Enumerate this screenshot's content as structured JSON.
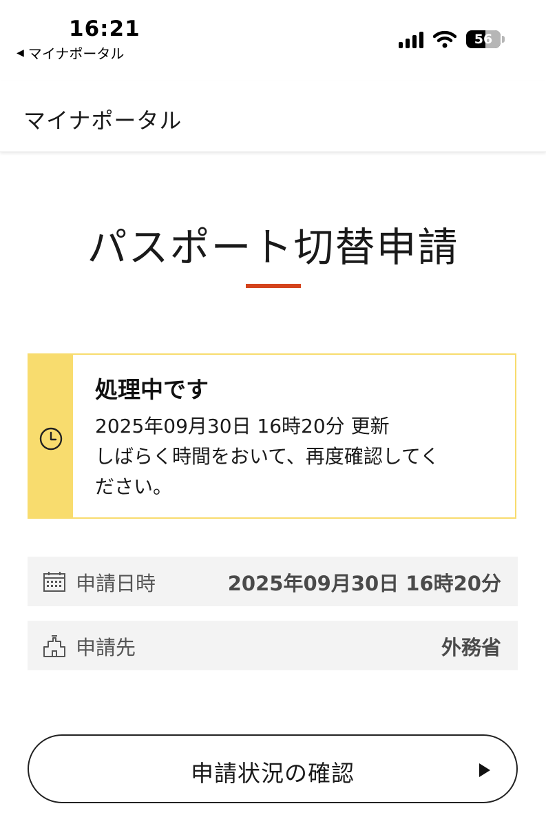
{
  "status_bar": {
    "time": "16:21",
    "back_arrow": "◀",
    "back_label": "マイナポータル",
    "battery": "56",
    "icons": [
      "cellular-signal-icon",
      "wifi-icon",
      "battery-icon"
    ]
  },
  "header": {
    "title": "マイナポータル"
  },
  "page": {
    "title": "パスポート切替申請",
    "accent_color": "#d4431c"
  },
  "status_box": {
    "heading": "処理中です",
    "updated": "2025年09月30日 16時20分 更新",
    "message_line1": "しばらく時間をおいて、再度確認してく",
    "message_line2": "ださい。",
    "icon": "clock-icon",
    "color": "#f8dc6e"
  },
  "info": {
    "date_label": "申請日時",
    "date_value": "2025年09月30日 16時20分",
    "date_icon": "calendar-icon",
    "dest_label": "申請先",
    "dest_value": "外務省",
    "dest_icon": "building-icon"
  },
  "actions": {
    "check_status": "申請状況の確認",
    "check_icon": "play-arrow-icon"
  }
}
